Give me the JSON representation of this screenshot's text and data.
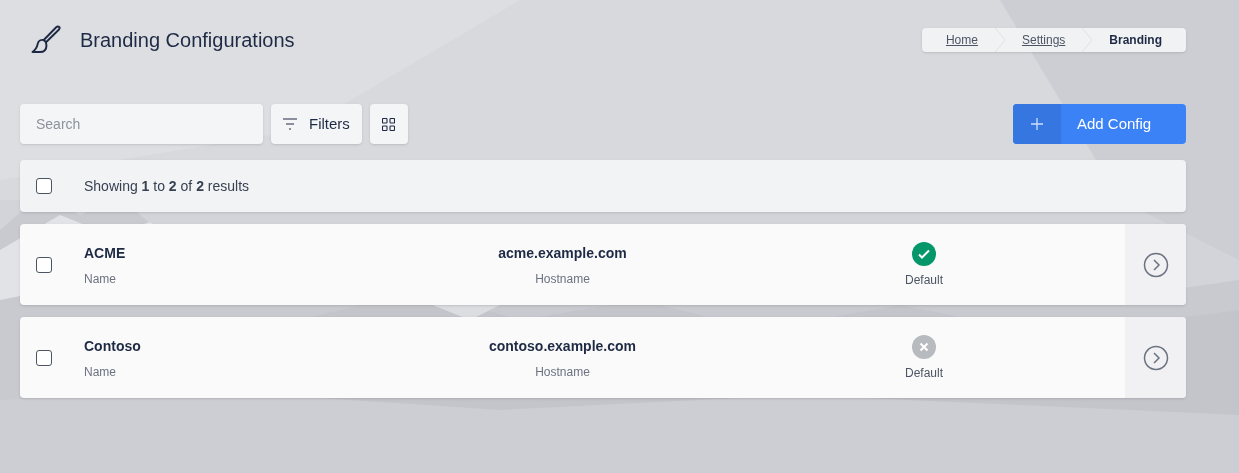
{
  "page": {
    "title": "Branding Configurations"
  },
  "breadcrumb": [
    {
      "label": "Home",
      "current": false
    },
    {
      "label": "Settings",
      "current": false
    },
    {
      "label": "Branding",
      "current": true
    }
  ],
  "toolbar": {
    "search": {
      "placeholder": "Search"
    },
    "filters_button": "Filters",
    "add_button": "Add Config"
  },
  "results": {
    "summary": "Showing **1** to **2** of **2** results",
    "select_all_checked": false
  },
  "rows": [
    {
      "name": "ACME",
      "name_label": "Name",
      "hostname": "acme.example.com",
      "hostname_label": "Hostname",
      "default": true,
      "default_label": "Default",
      "checked": false
    },
    {
      "name": "Contoso",
      "name_label": "Name",
      "hostname": "contoso.example.com",
      "hostname_label": "Hostname",
      "default": false,
      "default_label": "Default",
      "checked": false
    }
  ]
}
